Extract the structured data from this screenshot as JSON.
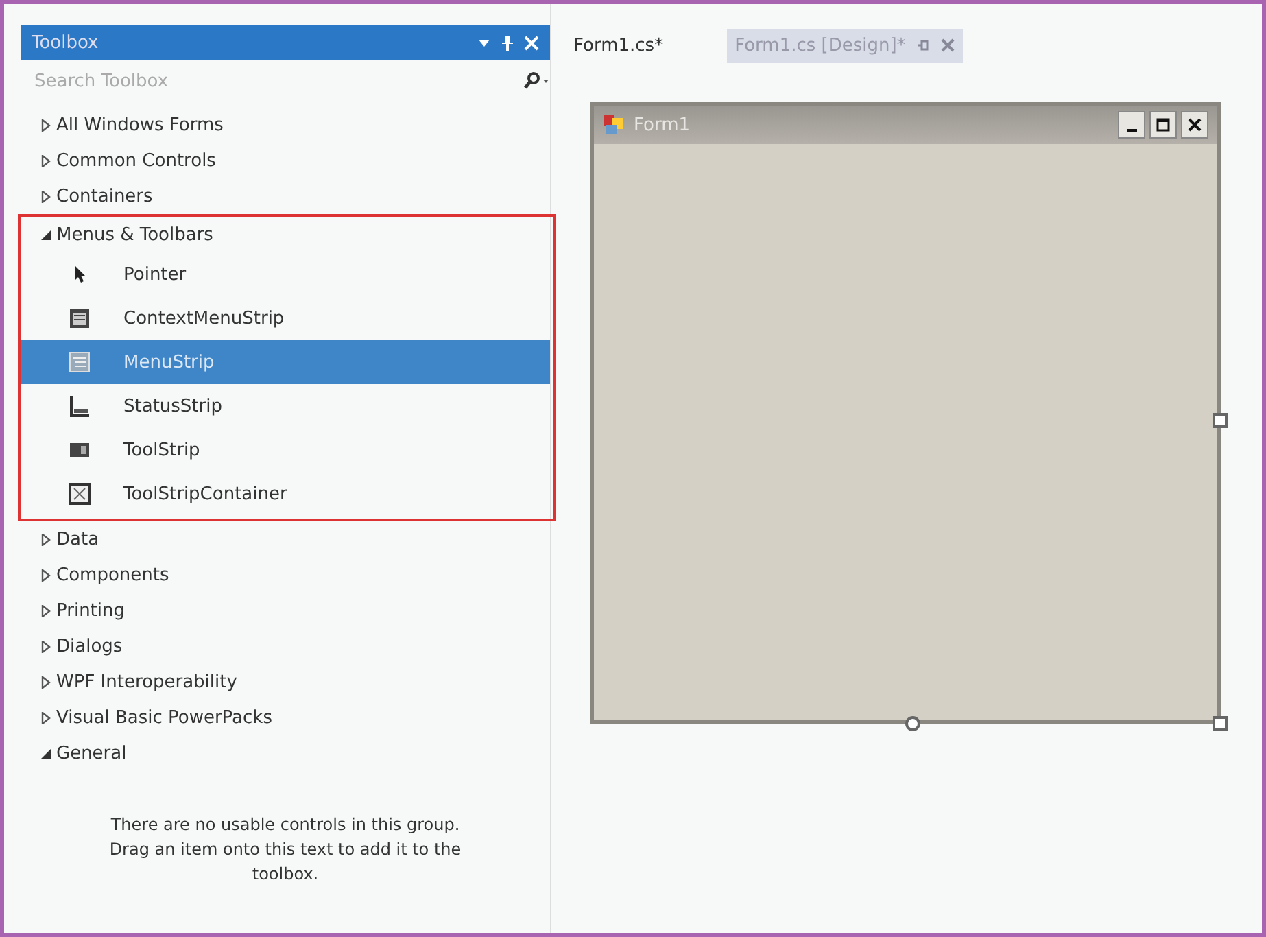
{
  "toolbox": {
    "title": "Toolbox",
    "search": {
      "placeholder": "Search Toolbox"
    },
    "categories": [
      {
        "label": "All Windows Forms",
        "expanded": false,
        "highlighted": false
      },
      {
        "label": "Common Controls",
        "expanded": false,
        "highlighted": false
      },
      {
        "label": "Containers",
        "expanded": false,
        "highlighted": false
      },
      {
        "label": "Menus & Toolbars",
        "expanded": true,
        "highlighted": true,
        "items": [
          {
            "label": "Pointer",
            "kind": "pointer",
            "selected": false
          },
          {
            "label": "ContextMenuStrip",
            "kind": "context",
            "selected": false
          },
          {
            "label": "MenuStrip",
            "kind": "menu",
            "selected": true
          },
          {
            "label": "StatusStrip",
            "kind": "status",
            "selected": false
          },
          {
            "label": "ToolStrip",
            "kind": "toolstrip",
            "selected": false
          },
          {
            "label": "ToolStripContainer",
            "kind": "container",
            "selected": false
          }
        ]
      },
      {
        "label": "Data",
        "expanded": false,
        "highlighted": false
      },
      {
        "label": "Components",
        "expanded": false,
        "highlighted": false
      },
      {
        "label": "Printing",
        "expanded": false,
        "highlighted": false
      },
      {
        "label": "Dialogs",
        "expanded": false,
        "highlighted": false
      },
      {
        "label": "WPF Interoperability",
        "expanded": false,
        "highlighted": false
      },
      {
        "label": "Visual Basic PowerPacks",
        "expanded": false,
        "highlighted": false
      },
      {
        "label": "General",
        "expanded": true,
        "highlighted": false,
        "empty_message": "There are no usable controls in this group. Drag an item onto this text to add it to the toolbox."
      }
    ]
  },
  "editor": {
    "tabs": [
      {
        "label": "Form1.cs*",
        "selected": false
      },
      {
        "label": "Form1.cs [Design]*",
        "selected": true
      }
    ],
    "form": {
      "title": "Form1"
    }
  }
}
